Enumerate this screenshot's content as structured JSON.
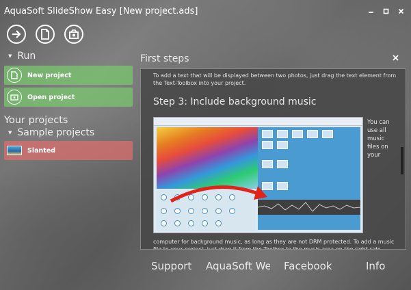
{
  "window": {
    "title": "AquaSoft SlideShow Easy [New project.ads]",
    "controls": [
      "✕",
      "–",
      "□",
      "✕"
    ]
  },
  "toolbar": {
    "icons": [
      "arrow-right-icon",
      "document-icon",
      "image-icon"
    ]
  },
  "sidebar": {
    "run_label": "Run",
    "new_project_label": "New project",
    "open_project_label": "Open project",
    "your_projects_label": "Your projects",
    "sample_projects_label": "Sample projects",
    "sample_items": [
      {
        "label": "Slanted"
      }
    ]
  },
  "panel": {
    "title": "First steps",
    "close": "✕",
    "text_top": "To add a text that will be displayed between two photos, just drag the text element from the Text-Toolbox into your project.",
    "step_title": "Step 3: Include background music",
    "text_side": "You can use all music files on your",
    "text_bottom": "computer for background music, as long as they are not DRM protected. To add a music file to your project, just drag it from the Toolbox to the music area on the right side."
  },
  "footer": {
    "links": [
      {
        "label": "Support"
      },
      {
        "label": "AquaSoft Website"
      },
      {
        "label": "Facebook"
      },
      {
        "label": "Info"
      }
    ]
  },
  "colors": {
    "green_action": "#78c86e",
    "red_action": "#dc6e6e",
    "accent_blue": "#4a9bd1"
  }
}
